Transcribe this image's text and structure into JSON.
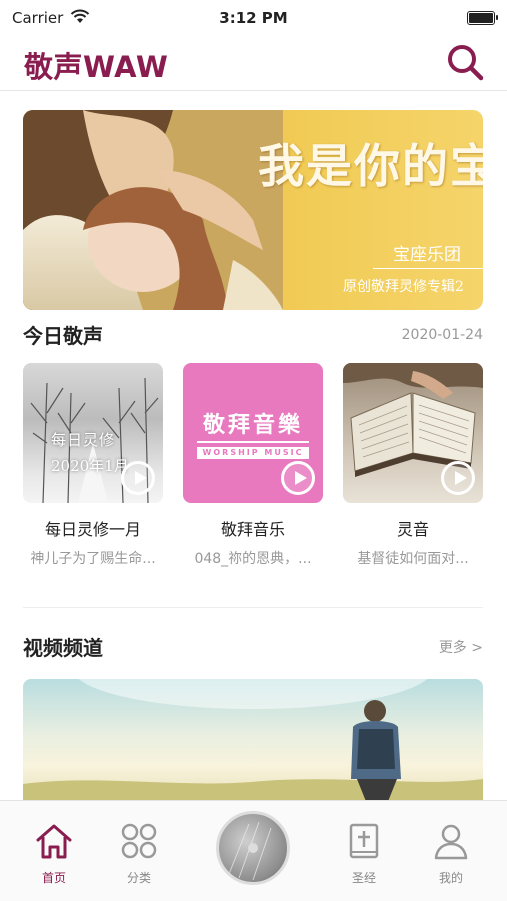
{
  "status_bar": {
    "carrier": "Carrier",
    "time": "3:12 PM"
  },
  "header": {
    "title": "敬声WAW",
    "search_icon": "search-icon"
  },
  "banner": {
    "headline": "我是你的宝",
    "band": "宝座乐团",
    "subtitle": "原创敬拜灵修专辑2"
  },
  "today": {
    "title": "今日敬声",
    "date": "2020-01-24",
    "cards": [
      {
        "name": "每日灵修一月",
        "desc": "神儿子为了赐生命...",
        "overlay_line1": "每日灵修",
        "overlay_line2": "2020年1月"
      },
      {
        "name": "敬拜音乐",
        "desc": "048_祢的恩典，...",
        "overlay_title": "敬拜音樂",
        "overlay_sub": "WORSHIP MUSIC"
      },
      {
        "name": "灵音",
        "desc": "基督徒如何面对..."
      }
    ]
  },
  "video": {
    "title": "视频频道",
    "more": "更多 >"
  },
  "tabbar": {
    "items": [
      {
        "label": "首页",
        "icon": "home-icon"
      },
      {
        "label": "分类",
        "icon": "category-icon"
      },
      {
        "label": "圣经",
        "icon": "bible-icon"
      },
      {
        "label": "我的",
        "icon": "profile-icon"
      }
    ]
  },
  "colors": {
    "accent": "#8a1d4f",
    "pink_card": "#e879bf"
  }
}
